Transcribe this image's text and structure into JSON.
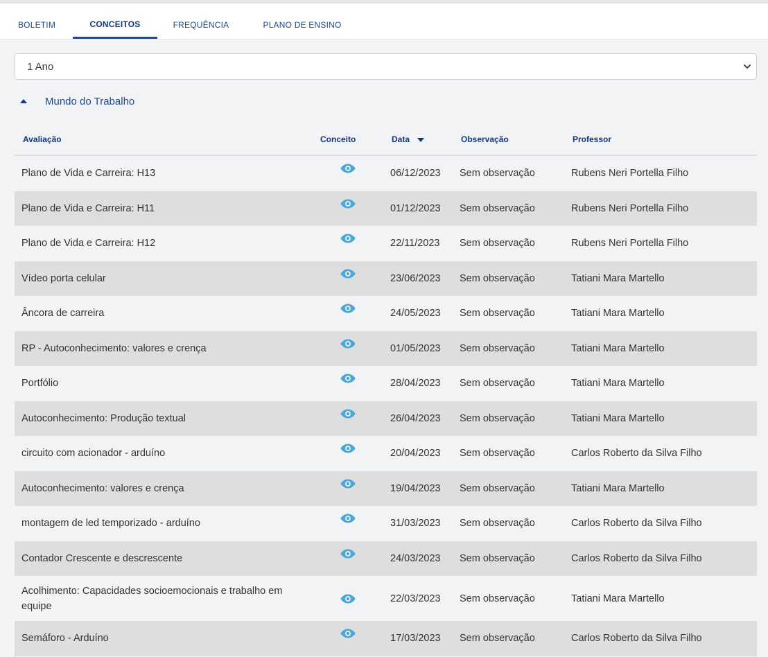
{
  "tabs": [
    {
      "label": "BOLETIM",
      "active": false
    },
    {
      "label": "CONCEITOS",
      "active": true
    },
    {
      "label": "FREQUÊNCIA",
      "active": false
    },
    {
      "label": "PLANO DE ENSINO",
      "active": false
    }
  ],
  "year_select": {
    "value": "1 Ano"
  },
  "group": {
    "title": "Mundo do Trabalho",
    "expanded": true
  },
  "table": {
    "headers": {
      "avaliacao": "Avaliação",
      "conceito": "Conceito",
      "data": "Data",
      "observacao": "Observação",
      "professor": "Professor"
    },
    "rows": [
      {
        "avaliacao": "Plano de Vida e Carreira: H13",
        "data": "06/12/2023",
        "observacao": "Sem observação",
        "professor": "Rubens Neri Portella Filho"
      },
      {
        "avaliacao": "Plano de Vida e Carreira: H11",
        "data": "01/12/2023",
        "observacao": "Sem observação",
        "professor": "Rubens Neri Portella Filho"
      },
      {
        "avaliacao": "Plano de Vida e Carreira: H12",
        "data": "22/11/2023",
        "observacao": "Sem observação",
        "professor": "Rubens Neri Portella Filho"
      },
      {
        "avaliacao": "Vídeo porta celular",
        "data": "23/06/2023",
        "observacao": "Sem observação",
        "professor": "Tatiani Mara Martello"
      },
      {
        "avaliacao": "Âncora de carreira",
        "data": "24/05/2023",
        "observacao": "Sem observação",
        "professor": "Tatiani Mara Martello"
      },
      {
        "avaliacao": "RP - Autoconhecimento: valores e crença",
        "data": "01/05/2023",
        "observacao": "Sem observação",
        "professor": "Tatiani Mara Martello"
      },
      {
        "avaliacao": "Portfólio",
        "data": "28/04/2023",
        "observacao": "Sem observação",
        "professor": "Tatiani Mara Martello"
      },
      {
        "avaliacao": "Autoconhecimento: Produção textual",
        "data": "26/04/2023",
        "observacao": "Sem observação",
        "professor": "Tatiani Mara Martello"
      },
      {
        "avaliacao": "circuito com acionador - arduíno",
        "data": "20/04/2023",
        "observacao": "Sem observação",
        "professor": "Carlos Roberto da Silva Filho"
      },
      {
        "avaliacao": "Autoconhecimento: valores e crença",
        "data": "19/04/2023",
        "observacao": "Sem observação",
        "professor": "Tatiani Mara Martello"
      },
      {
        "avaliacao": "montagem de led temporizado - arduíno",
        "data": "31/03/2023",
        "observacao": "Sem observação",
        "professor": "Carlos Roberto da Silva Filho"
      },
      {
        "avaliacao": "Contador Crescente e descrescente",
        "data": "24/03/2023",
        "observacao": "Sem observação",
        "professor": "Carlos Roberto da Silva Filho"
      },
      {
        "avaliacao": "Acolhimento: Capacidades socioemocionais e trabalho em equipe",
        "data": "22/03/2023",
        "observacao": "Sem observação",
        "professor": "Tatiani Mara Martello"
      },
      {
        "avaliacao": "Semáforo - Arduíno",
        "data": "17/03/2023",
        "observacao": "Sem observação",
        "professor": "Carlos Roberto da Silva Filho"
      }
    ]
  },
  "colors": {
    "link": "#1a4b9b",
    "eye_icon": "#4aa8d8",
    "row_alt": "#dedede",
    "row_base": "#f2f3f5"
  },
  "icons": {
    "conceito": "eye-icon",
    "sort": "caret-down-icon",
    "group_toggle": "caret-up-icon",
    "select": "chevron-down-icon"
  }
}
